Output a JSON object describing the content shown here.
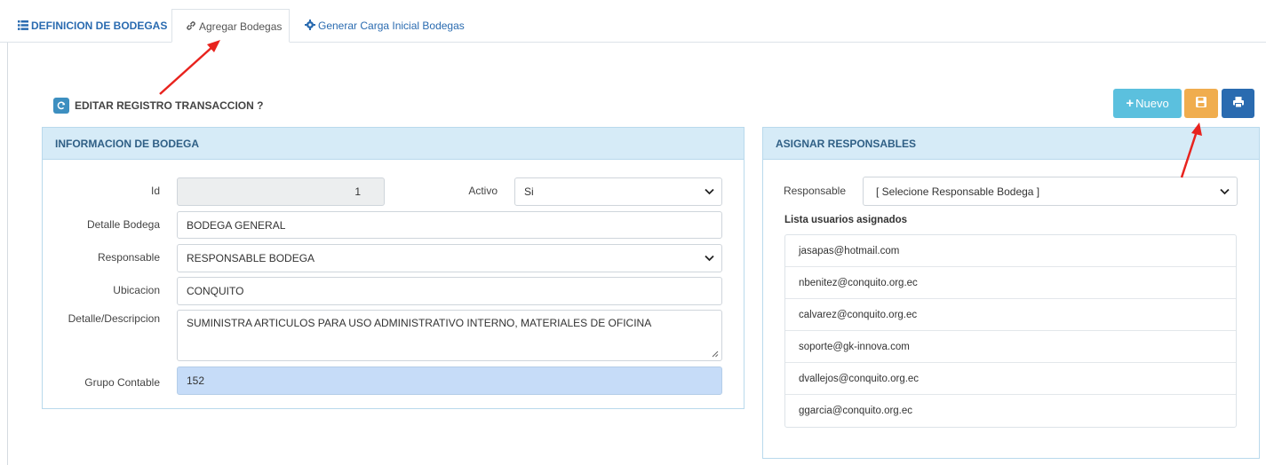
{
  "tabs": {
    "definicion": "DEFINICION DE BODEGAS",
    "agregar": "Agregar Bodegas",
    "generar": "Generar Carga Inicial Bodegas"
  },
  "edit_title": "EDITAR REGISTRO TRANSACCION ?",
  "actions": {
    "nuevo_label": "Nuevo"
  },
  "info_panel": {
    "title": "INFORMACION DE BODEGA",
    "id_label": "Id",
    "id_value": "1",
    "activo_label": "Activo",
    "activo_value": "Si",
    "detalle_label": "Detalle Bodega",
    "detalle_value": "BODEGA GENERAL",
    "responsable_label": "Responsable",
    "responsable_value": "RESPONSABLE BODEGA",
    "ubicacion_label": "Ubicacion",
    "ubicacion_value": "CONQUITO",
    "descripcion_label": "Detalle/Descripcion",
    "descripcion_value": "SUMINISTRA ARTICULOS PARA USO ADMINISTRATIVO INTERNO, MATERIALES DE OFICINA",
    "grupo_label": "Grupo Contable",
    "grupo_value": "152"
  },
  "assign_panel": {
    "title": "ASIGNAR RESPONSABLES",
    "responsable_label": "Responsable",
    "responsable_value": "[ Selecione Responsable Bodega ]",
    "list_title": "Lista usuarios asignados",
    "users": [
      "jasapas@hotmail.com",
      "nbenitez@conquito.org.ec",
      "calvarez@conquito.org.ec",
      "soporte@gk-innova.com",
      "dvallejos@conquito.org.ec",
      "ggarcia@conquito.org.ec"
    ]
  },
  "colors": {
    "accent": "#2a6bb0",
    "nuevo_button": "#5bc0de",
    "save_button": "#f0ad4e",
    "print_button": "#2a6bb0",
    "panel_header": "#d6ebf7",
    "annotation_arrow": "#e8231e"
  },
  "icons": {
    "tab_definicion": "list-icon",
    "tab_agregar": "link-icon",
    "tab_generar": "gear-icon",
    "edit_title": "refresh-icon",
    "nuevo": "plus-icon",
    "save": "save-icon",
    "print": "print-icon"
  }
}
